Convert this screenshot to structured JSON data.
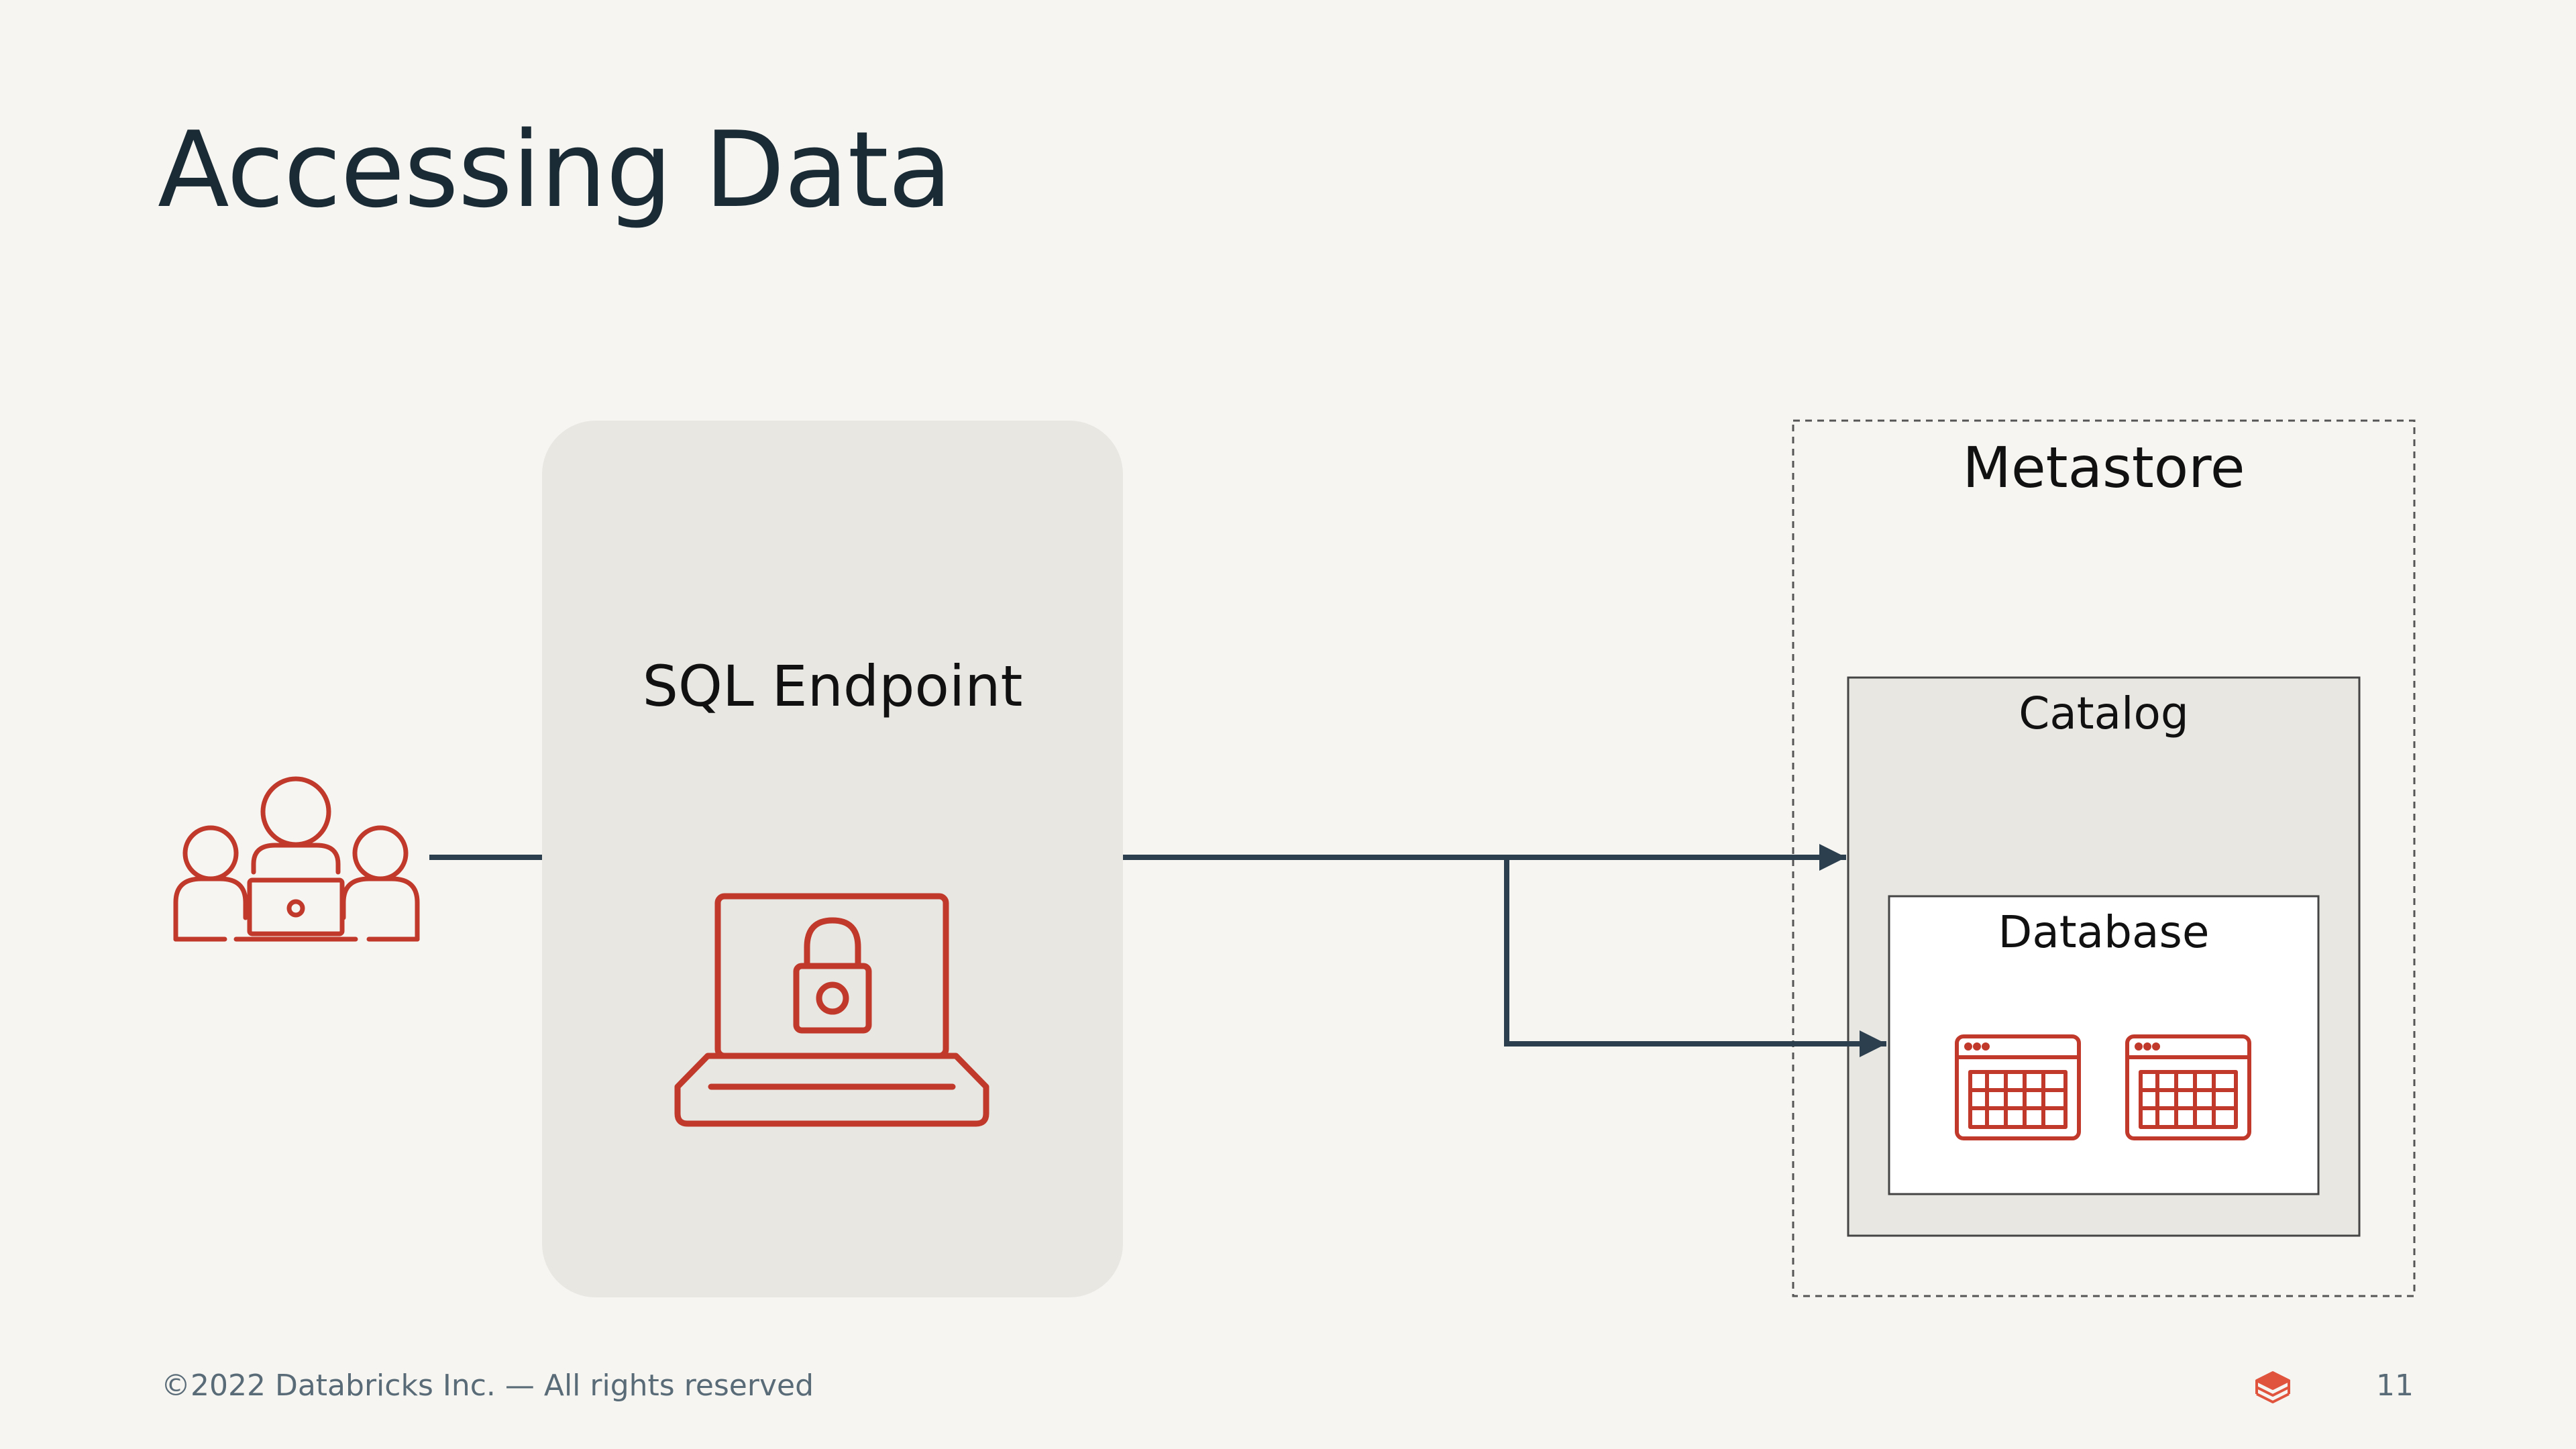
{
  "slide": {
    "title": "Accessing Data",
    "footer": "©2022 Databricks Inc. — All rights reserved",
    "page_number": "11"
  },
  "diagram": {
    "users_icon": "users-with-laptop-icon",
    "sql_endpoint": {
      "label": "SQL Endpoint",
      "icon": "laptop-lock-icon"
    },
    "metastore": {
      "label": "Metastore",
      "catalog": {
        "label": "Catalog",
        "database": {
          "label": "Database",
          "icons": [
            "table-icon",
            "table-icon"
          ]
        }
      }
    },
    "colors": {
      "accent": "#c0392b",
      "connector": "#2b3f4f",
      "endpoint_fill": "#e9e7e2",
      "catalog_fill": "#e9e7e2",
      "database_fill": "#ffffff",
      "background": "#f6f5f1"
    }
  },
  "logo_icon": "databricks-logo-icon"
}
